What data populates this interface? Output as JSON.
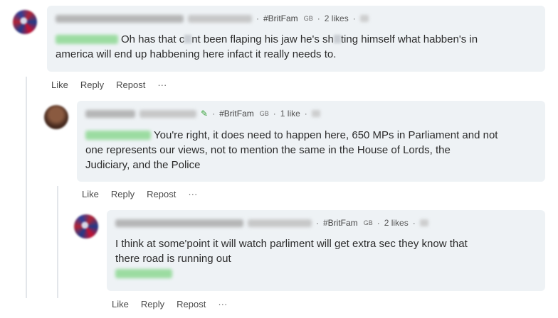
{
  "comments": [
    {
      "tag": "#BritFam",
      "flair": "GB",
      "likes": "2 likes",
      "body_pre": "Oh has that c",
      "body_mid": "nt been flaping his jaw he's sh",
      "body_post": "ting himself what habben's in",
      "body_line2": "america will end up habbening here infact it really needs to."
    },
    {
      "tag": "#BritFam",
      "flair": "GB",
      "likes": "1 like",
      "body_line1": "You're right, it does need to happen here, 650 MPs in Parliament and not",
      "body_line2": "one represents our views, not to mention the same in the House of Lords, the",
      "body_line3": "Judiciary, and the Police"
    },
    {
      "tag": "#BritFam",
      "flair": "GB",
      "likes": "2 likes",
      "body_line1": "I think at some'point it will watch parliment will get extra sec they know that",
      "body_line2": "there road is running out"
    }
  ],
  "actions": {
    "like": "Like",
    "reply": "Reply",
    "repost": "Repost",
    "more": "···"
  },
  "separator": "·",
  "icons": {
    "more": "more-horizontal-icon",
    "edit": "pencil-icon"
  }
}
